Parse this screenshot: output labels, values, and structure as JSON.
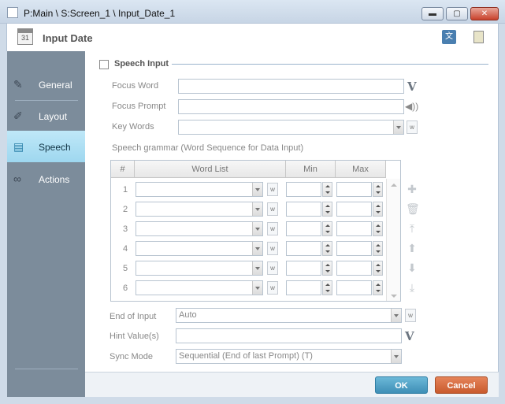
{
  "window": {
    "title": "P:Main \\ S:Screen_1 \\ Input_Date_1",
    "minimize_glyph": "▬",
    "maximize_glyph": "▢",
    "close_glyph": "✕"
  },
  "header": {
    "calendar_day": "31",
    "title": "Input Date"
  },
  "sidebar": {
    "items": [
      {
        "label": "General",
        "icon": "pencil-icon"
      },
      {
        "label": "Layout",
        "icon": "ruler-icon"
      },
      {
        "label": "Speech",
        "icon": "speech-bubble-icon"
      },
      {
        "label": "Actions",
        "icon": "chain-link-icon"
      }
    ]
  },
  "speech": {
    "section_label": "Speech Input",
    "focus_word_label": "Focus Word",
    "focus_word_value": "",
    "focus_prompt_label": "Focus Prompt",
    "focus_prompt_value": "",
    "key_words_label": "Key Words",
    "key_words_value": "",
    "grammar_label": "Speech grammar (Word Sequence for Data Input)",
    "w_glyph": "w",
    "v_glyph": "V",
    "grid": {
      "columns": [
        "#",
        "Word List",
        "Min",
        "Max"
      ],
      "rows": [
        "1",
        "2",
        "3",
        "4",
        "5",
        "6"
      ]
    },
    "end_of_input_label": "End of Input",
    "end_of_input_value": "Auto",
    "hint_value_label": "Hint Value(s)",
    "hint_value_value": "",
    "sync_mode_label": "Sync Mode",
    "sync_mode_value": "Sequential (End of last Prompt) (T)"
  },
  "footer": {
    "ok_label": "OK",
    "cancel_label": "Cancel"
  }
}
